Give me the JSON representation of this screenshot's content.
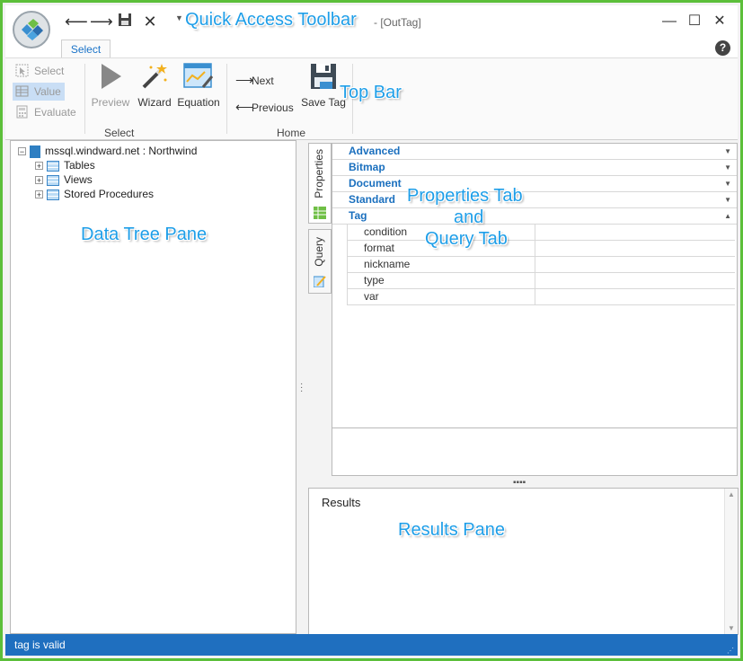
{
  "window": {
    "title": "- [OutTag]"
  },
  "tabs": {
    "select": "Select"
  },
  "ribbon": {
    "select_group": {
      "label": "Select",
      "select": "Select",
      "value": "Value",
      "evaluate": "Evaluate",
      "preview": "Preview",
      "wizard": "Wizard",
      "equation": "Equation"
    },
    "home_group": {
      "label": "Home",
      "next": "Next",
      "previous": "Previous",
      "save_tag": "Save Tag"
    }
  },
  "annotations": {
    "quick_access_toolbar": "Quick Access Toolbar",
    "top_bar": "Top Bar",
    "data_tree_pane": "Data Tree Pane",
    "properties_tab_line1": "Properties Tab",
    "properties_tab_line2": "and",
    "properties_tab_line3": "Query Tab",
    "results_pane": "Results Pane"
  },
  "tree": {
    "root": "mssql.windward.net : Northwind",
    "children": [
      "Tables",
      "Views",
      "Stored Procedures"
    ]
  },
  "side_tabs": {
    "properties": "Properties",
    "query": "Query"
  },
  "properties": {
    "categories": [
      "Advanced",
      "Bitmap",
      "Document",
      "Standard",
      "Tag"
    ],
    "tag_props": [
      "condition",
      "format",
      "nickname",
      "type",
      "var"
    ]
  },
  "results": {
    "title": "Results"
  },
  "status": {
    "text": "tag is valid"
  },
  "colors": {
    "accent": "#1f6fbf",
    "frame": "#5cbf3a",
    "annotation": "#1e9ee8"
  }
}
